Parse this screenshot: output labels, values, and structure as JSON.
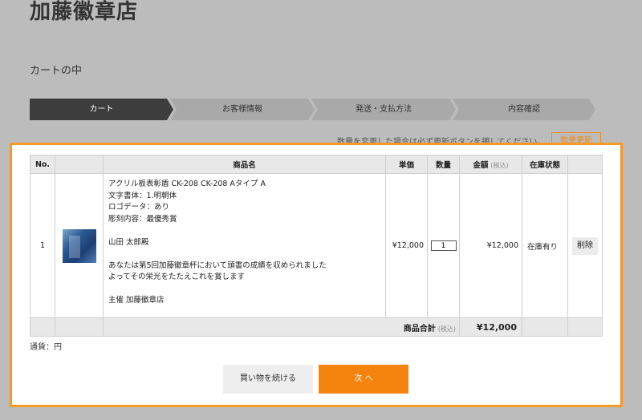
{
  "shop": {
    "title": "加藤徽章店"
  },
  "page": {
    "section_title": "カートの中"
  },
  "steps": [
    {
      "label": "カート",
      "active": true
    },
    {
      "label": "お客様情報",
      "active": false
    },
    {
      "label": "発送・支払方法",
      "active": false
    },
    {
      "label": "内容確認",
      "active": false
    }
  ],
  "notice": {
    "text": "数量を変更した場合は必ず更新ボタンを押してください。",
    "update_button": "数量更新"
  },
  "table": {
    "headers": {
      "no": "No.",
      "image": "",
      "name": "商品名",
      "unit_price": "単価",
      "quantity": "数量",
      "amount": "金額",
      "tax_note": "(税込)",
      "stock": "在庫状態",
      "action": ""
    },
    "items": [
      {
        "no": "1",
        "image_icon": "product-thumbnail",
        "name_lines": [
          "アクリル板表彰盾 CK-208 CK-208 Aタイプ A",
          "文字書体：1.明朝体",
          "ロゴデータ：あり",
          "彫刻内容：最優秀賞",
          "",
          "山田 太郎殿",
          "",
          "あなたは第5回加藤徽章杯において頭書の成績を収められました",
          "よってその栄光をたたえこれを賞します",
          "",
          "主催 加藤徽章店"
        ],
        "unit_price": "¥12,000",
        "quantity": "1",
        "amount": "¥12,000",
        "stock": "在庫有り",
        "delete_label": "削除"
      }
    ],
    "total": {
      "label": "商品合計",
      "tax_note": "(税込)",
      "value": "¥12,000"
    }
  },
  "currency_note": "通貨：円",
  "buttons": {
    "continue": "買い物を続ける",
    "next": "次 へ"
  }
}
